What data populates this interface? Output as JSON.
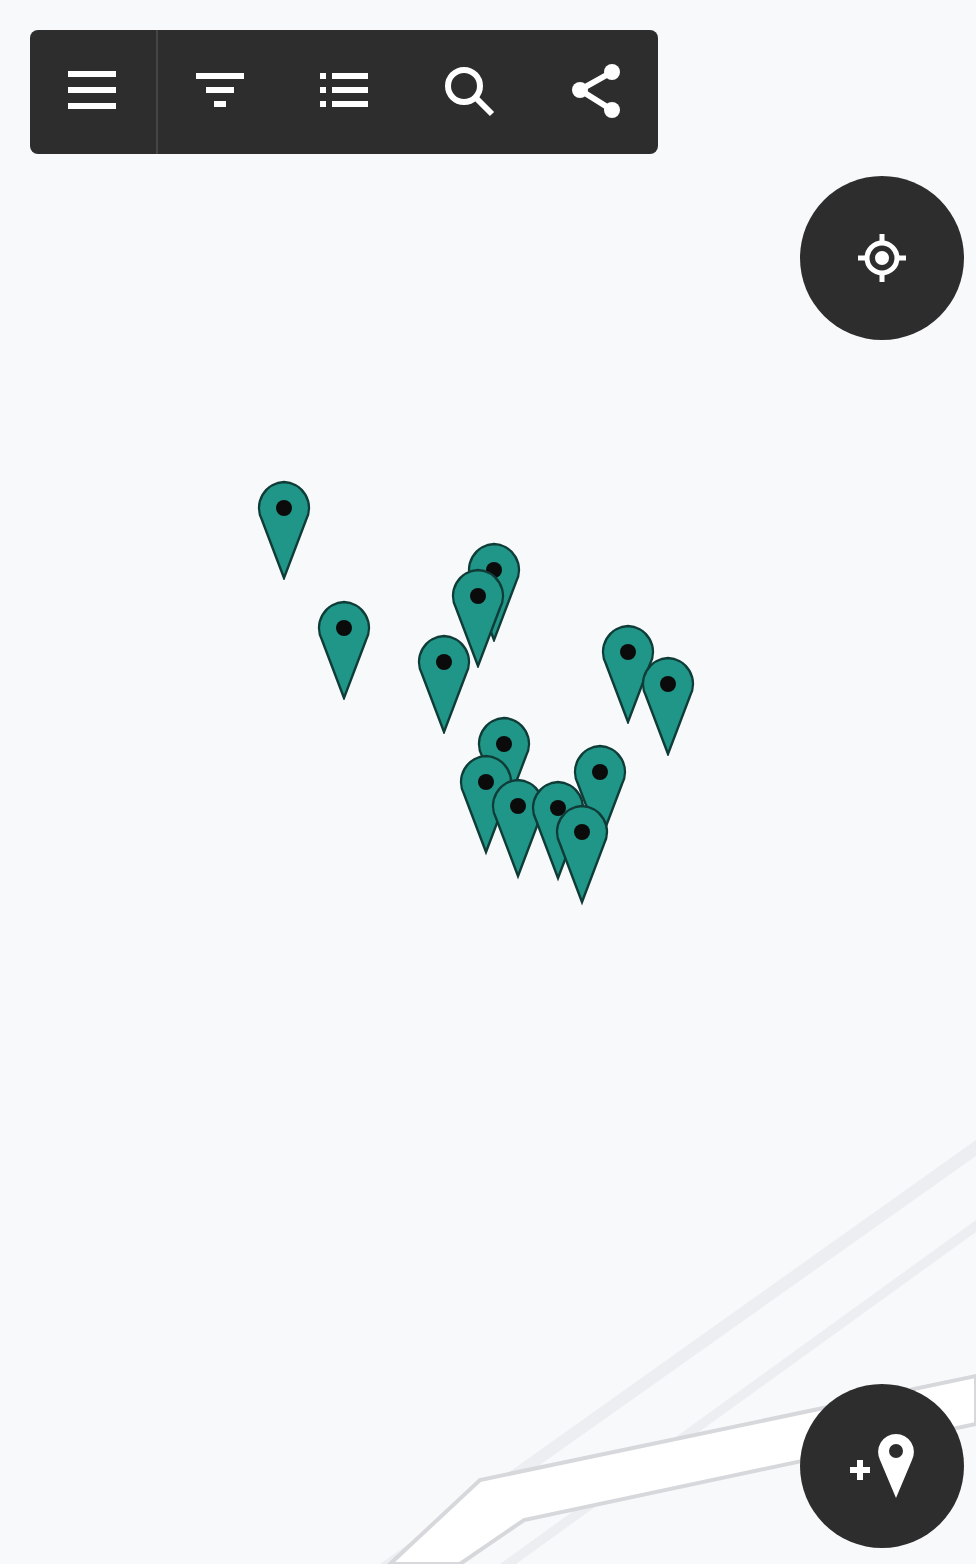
{
  "toolbar": [
    {
      "kind": "menu"
    },
    {
      "kind": "filter"
    },
    {
      "kind": "list"
    },
    {
      "kind": "search"
    },
    {
      "kind": "share"
    }
  ],
  "map": {
    "kind": "picture",
    "markers": [
      {
        "kind": "pin"
      },
      {
        "kind": "pin"
      },
      {
        "kind": "pin"
      },
      {
        "kind": "pin"
      },
      {
        "kind": "pin"
      },
      {
        "kind": "pin"
      },
      {
        "kind": "pin"
      },
      {
        "kind": "pin"
      },
      {
        "kind": "pin"
      },
      {
        "kind": "pin"
      },
      {
        "kind": "pin"
      },
      {
        "kind": "pin"
      },
      {
        "kind": "pin"
      }
    ]
  },
  "fabs": [
    {
      "kind": "locate"
    },
    {
      "kind": "add_pin"
    }
  ]
}
